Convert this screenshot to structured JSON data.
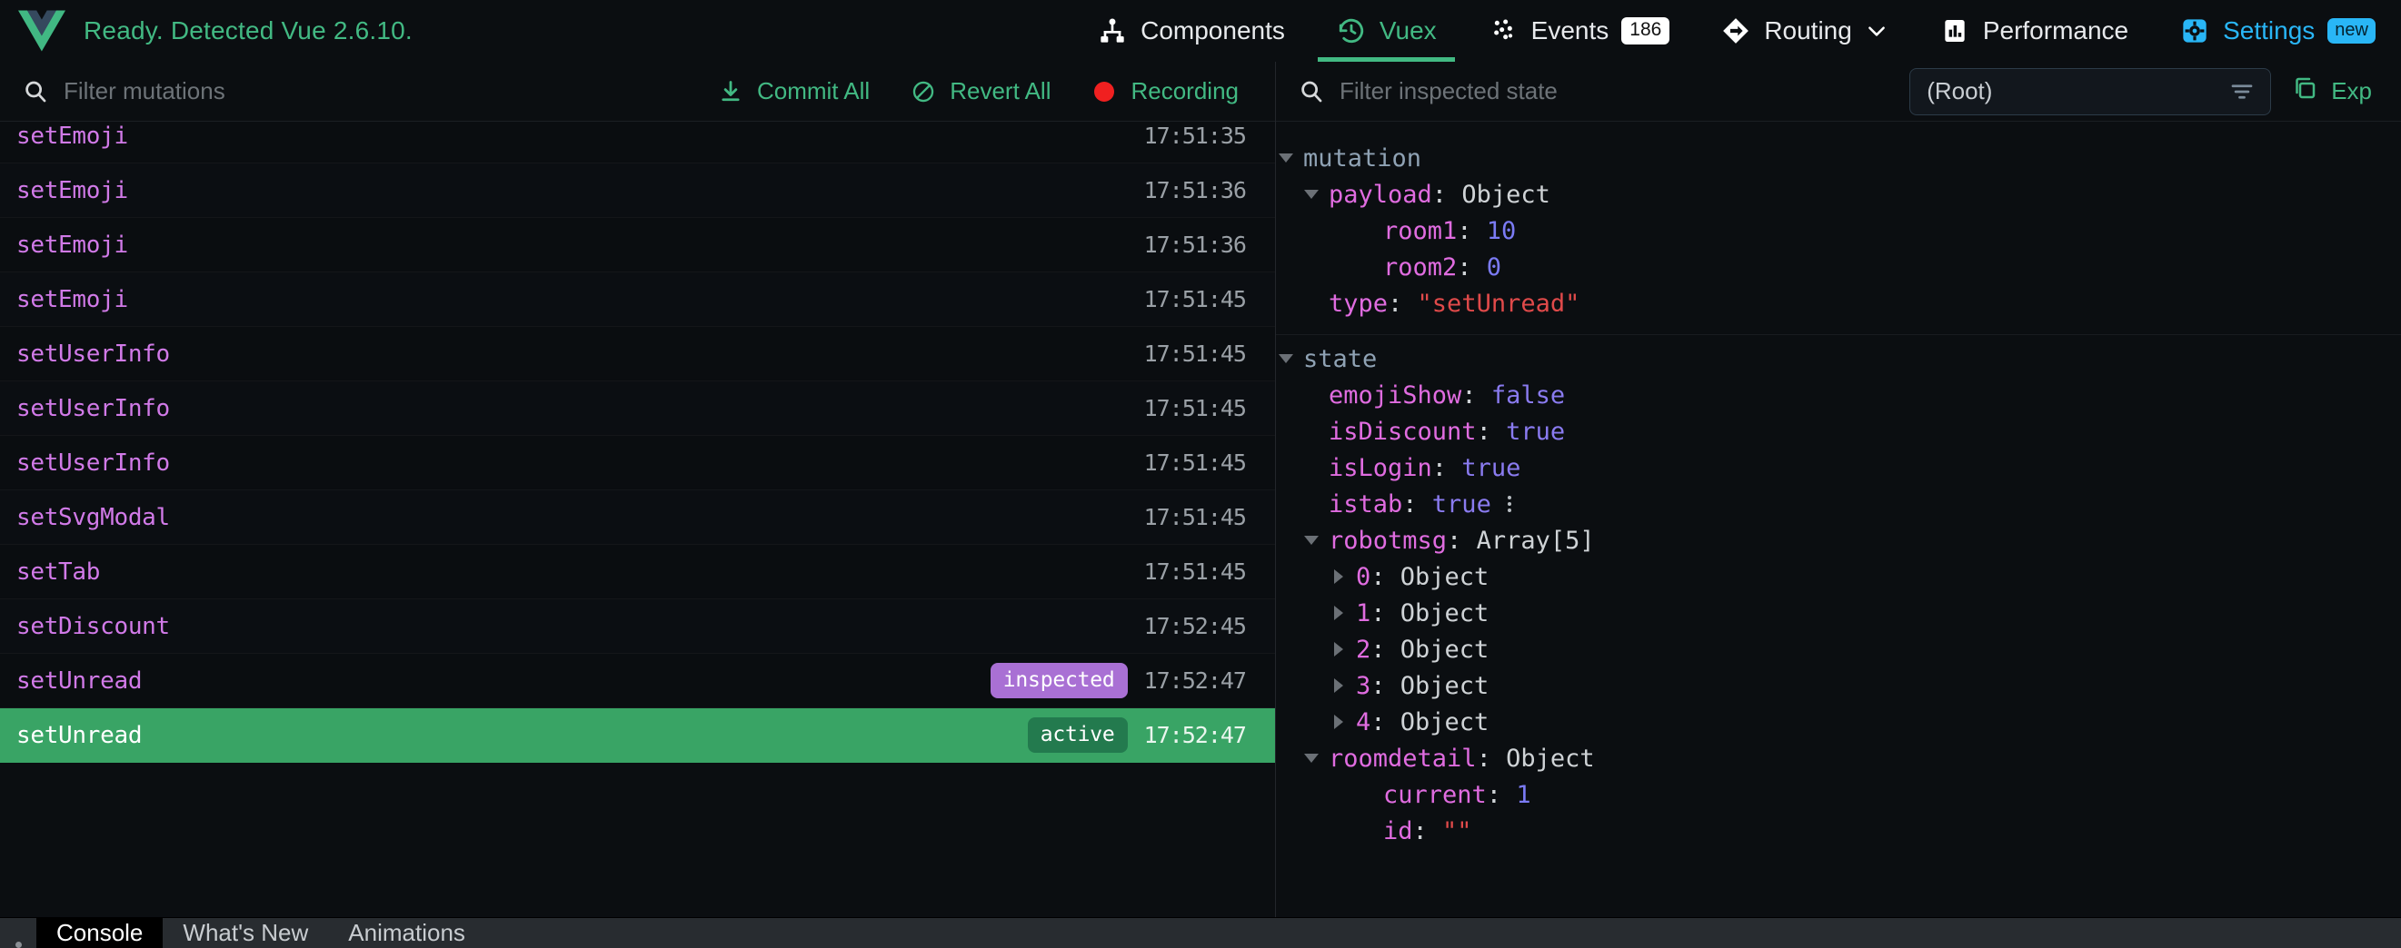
{
  "header": {
    "logo_icon": "vue-logo",
    "status_text": "Ready. Detected Vue 2.6.10.",
    "tabs": [
      {
        "label": "Components",
        "icon": "components-icon",
        "active": false
      },
      {
        "label": "Vuex",
        "icon": "history-clock-icon",
        "active": true
      },
      {
        "label": "Events",
        "icon": "events-dots-icon",
        "badge": "186",
        "active": false
      },
      {
        "label": "Routing",
        "icon": "routing-diamond-icon",
        "chevron": "chevron-down-icon",
        "active": false
      },
      {
        "label": "Performance",
        "icon": "bar-chart-icon",
        "active": false
      },
      {
        "label": "Settings",
        "icon": "gear-icon",
        "badge_new": "new",
        "active": false
      }
    ]
  },
  "left_toolbar": {
    "search_icon": "search-icon",
    "filter_placeholder": "Filter mutations",
    "filter_value": "",
    "commit_all_label": "Commit All",
    "commit_all_icon": "download-icon",
    "revert_all_label": "Revert All",
    "revert_all_icon": "no-entry-icon",
    "recording_label": "Recording",
    "recording_icon": "record-dot-icon"
  },
  "right_toolbar": {
    "search_icon": "search-icon",
    "filter_placeholder": "Filter inspected state",
    "filter_value": "",
    "target_selector_value": "(Root)",
    "target_selector_icon": "filter-lines-icon",
    "export_label": "Exp",
    "export_icon": "copy-icon"
  },
  "mutations": [
    {
      "name": "setEmoji",
      "time": "17:51:35",
      "badge": "",
      "state": ""
    },
    {
      "name": "setEmoji",
      "time": "17:51:36",
      "badge": "",
      "state": ""
    },
    {
      "name": "setEmoji",
      "time": "17:51:36",
      "badge": "",
      "state": ""
    },
    {
      "name": "setEmoji",
      "time": "17:51:45",
      "badge": "",
      "state": ""
    },
    {
      "name": "setUserInfo",
      "time": "17:51:45",
      "badge": "",
      "state": ""
    },
    {
      "name": "setUserInfo",
      "time": "17:51:45",
      "badge": "",
      "state": ""
    },
    {
      "name": "setUserInfo",
      "time": "17:51:45",
      "badge": "",
      "state": ""
    },
    {
      "name": "setSvgModal",
      "time": "17:51:45",
      "badge": "",
      "state": ""
    },
    {
      "name": "setTab",
      "time": "17:51:45",
      "badge": "",
      "state": ""
    },
    {
      "name": "setDiscount",
      "time": "17:52:45",
      "badge": "",
      "state": ""
    },
    {
      "name": "setUnread",
      "time": "17:52:47",
      "badge": "inspected",
      "state": "inspected"
    },
    {
      "name": "setUnread",
      "time": "17:52:47",
      "badge": "active",
      "state": "active"
    }
  ],
  "state_tree": {
    "mutation": {
      "group_label": "mutation",
      "payload_key": "payload",
      "payload_type": "Object",
      "rows": [
        {
          "key": "room1",
          "value": "10",
          "kind": "num"
        },
        {
          "key": "room2",
          "value": "0",
          "kind": "num"
        }
      ],
      "type_key": "type",
      "type_value": "\"setUnread\""
    },
    "state": {
      "group_label": "state",
      "rows": [
        {
          "key": "emojiShow",
          "value": "false",
          "kind": "bool"
        },
        {
          "key": "isDiscount",
          "value": "true",
          "kind": "bool"
        },
        {
          "key": "isLogin",
          "value": "true",
          "kind": "bool"
        },
        {
          "key": "istab",
          "value": "true",
          "kind": "bool",
          "menu_icon": "kebab-menu-icon"
        }
      ],
      "robotmsg_key": "robotmsg",
      "robotmsg_type": "Array[5]",
      "robotmsg_items": [
        {
          "index": "0",
          "type": "Object"
        },
        {
          "index": "1",
          "type": "Object"
        },
        {
          "index": "2",
          "type": "Object"
        },
        {
          "index": "3",
          "type": "Object"
        },
        {
          "index": "4",
          "type": "Object"
        }
      ],
      "roomdetail_key": "roomdetail",
      "roomdetail_type": "Object",
      "roomdetail_rows": [
        {
          "key": "current",
          "value": "1",
          "kind": "num"
        },
        {
          "key": "id",
          "value": "\"\"",
          "kind": "str"
        }
      ]
    }
  },
  "drawer": {
    "tabs": [
      {
        "label": "Console",
        "selected": true
      },
      {
        "label": "What's New",
        "selected": false
      },
      {
        "label": "Animations",
        "selected": false
      }
    ]
  },
  "colors": {
    "bg": "#0b0e11",
    "vue_green": "#42b983",
    "settings_blue": "#29b6f6",
    "active_row_green": "#39a465",
    "inspected_purple": "#a970d4",
    "mutation_name_purple": "#d17ae8",
    "record_red": "#f02020",
    "key_pink": "#e06ce0",
    "number_blue": "#7b7bf5",
    "string_red": "#e04a4a"
  }
}
